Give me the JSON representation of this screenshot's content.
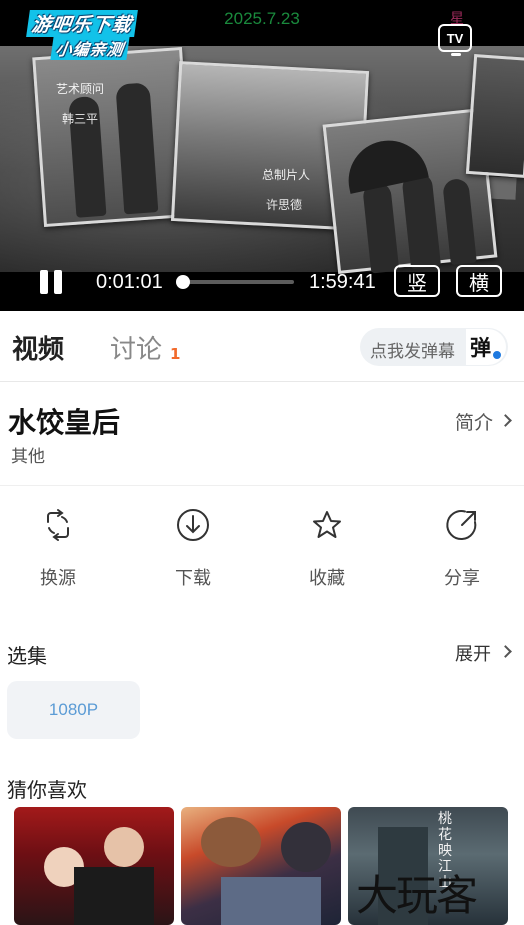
{
  "status_bar": {
    "date": "2025.7.23",
    "mark": "星"
  },
  "player": {
    "watermark": {
      "line1": "游吧乐下载",
      "line2": "小编亲测"
    },
    "tv_button": "TV",
    "overlay_texts": [
      "艺术顾问",
      "韩三平",
      "总制片人",
      "许思德"
    ],
    "current_time": "0:01:01",
    "duration": "1:59:41",
    "progress": 0.0085,
    "portrait_button": "竖",
    "landscape_button": "横"
  },
  "tabs": [
    {
      "label": "视频",
      "active": true
    },
    {
      "label": "讨论",
      "badge": "1",
      "active": false
    }
  ],
  "danmu": {
    "placeholder": "点我发弹幕",
    "icon_text": "弹"
  },
  "show": {
    "title": "水饺皇后",
    "category": "其他",
    "intro_label": "简介"
  },
  "actions": [
    {
      "label": "换源",
      "icon": "switch-source-icon"
    },
    {
      "label": "下载",
      "icon": "download-icon"
    },
    {
      "label": "收藏",
      "icon": "star-icon"
    },
    {
      "label": "分享",
      "icon": "share-icon"
    }
  ],
  "episodes": {
    "section_title": "选集",
    "expand_label": "展开",
    "items": [
      "1080P"
    ]
  },
  "recommendations": {
    "section_title": "猜你喜欢",
    "items": [
      {
        "poster_text": ""
      },
      {
        "poster_text": ""
      },
      {
        "poster_text": "大玩客",
        "vertical_text": "桃花映江山"
      }
    ]
  },
  "colors": {
    "accent_blue": "#5b9bd5",
    "badge_orange": "#f26a2b",
    "status_green": "#1a8a3d"
  }
}
